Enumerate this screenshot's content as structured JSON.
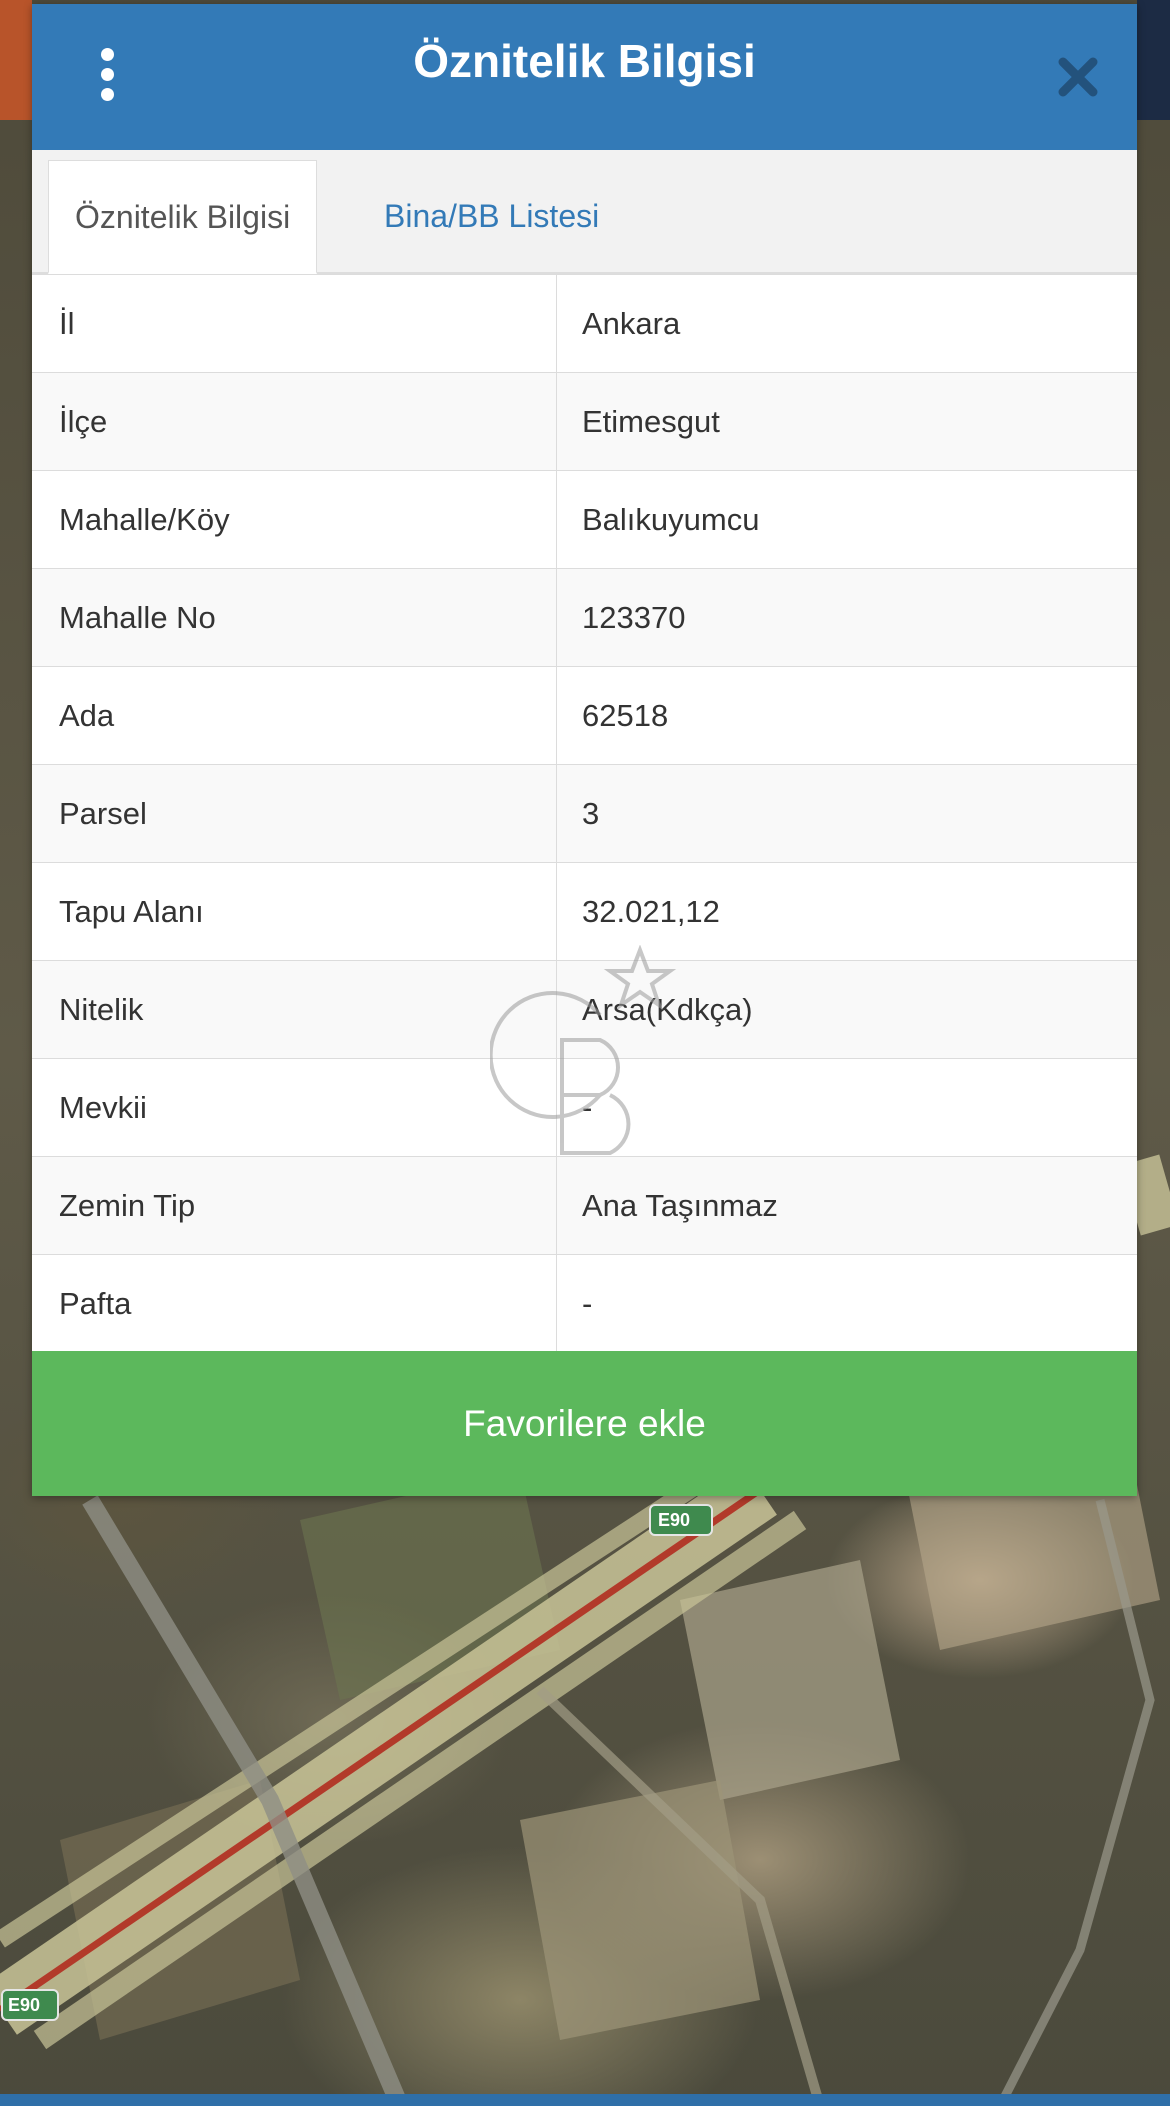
{
  "dialog": {
    "title": "Öznitelik Bilgisi",
    "menu_icon": "more-vertical-icon",
    "close_icon": "close-icon"
  },
  "tabs": [
    {
      "label": "Öznitelik Bilgisi",
      "active": true
    },
    {
      "label": "Bina/BB Listesi",
      "active": false
    }
  ],
  "attributes": [
    {
      "label": "İl",
      "value": "Ankara"
    },
    {
      "label": "İlçe",
      "value": "Etimesgut"
    },
    {
      "label": "Mahalle/Köy",
      "value": "Balıkuyumcu"
    },
    {
      "label": "Mahalle No",
      "value": "123370"
    },
    {
      "label": "Ada",
      "value": "62518"
    },
    {
      "label": "Parsel",
      "value": "3"
    },
    {
      "label": "Tapu Alanı",
      "value": "32.021,12"
    },
    {
      "label": "Nitelik",
      "value": "Arsa(Kdkça)"
    },
    {
      "label": "Mevkii",
      "value": "-"
    },
    {
      "label": "Zemin Tip",
      "value": "Ana Taşınmaz"
    },
    {
      "label": "Pafta",
      "value": "-"
    }
  ],
  "footer": {
    "favorite_label": "Favorilere ekle"
  },
  "map": {
    "road_signs": [
      "E90",
      "E90"
    ]
  },
  "colors": {
    "header": "#337ab7",
    "button": "#5cb85c",
    "tab_link": "#337ab7"
  }
}
